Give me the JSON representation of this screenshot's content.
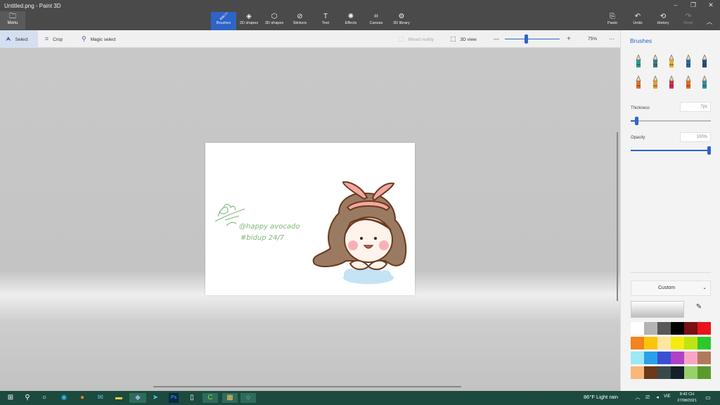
{
  "window": {
    "title": "Untitled.png - Paint 3D",
    "controls": [
      "–",
      "❐",
      "✕"
    ]
  },
  "ribbon": {
    "menu_label": "Menu",
    "tools": [
      {
        "label": "Brushes",
        "icon": "brush-icon",
        "glyph": "🖌"
      },
      {
        "label": "2D shapes",
        "icon": "shapes-2d-icon",
        "glyph": "◈"
      },
      {
        "label": "3D shapes",
        "icon": "cube-icon",
        "glyph": "⬡"
      },
      {
        "label": "Stickers",
        "icon": "sticker-icon",
        "glyph": "⊘"
      },
      {
        "label": "Text",
        "icon": "text-icon",
        "glyph": "T"
      },
      {
        "label": "Effects",
        "icon": "effects-icon",
        "glyph": "✺"
      },
      {
        "label": "Canvas",
        "icon": "canvas-icon",
        "glyph": "⌗"
      },
      {
        "label": "3D library",
        "icon": "library-icon",
        "glyph": "⚙"
      }
    ],
    "active_tool": "Brushes",
    "right_tools": [
      {
        "label": "Paste",
        "icon": "paste-icon",
        "glyph": "📋",
        "enabled": true
      },
      {
        "label": "Undo",
        "icon": "undo-icon",
        "glyph": "↶",
        "enabled": true
      },
      {
        "label": "History",
        "icon": "history-icon",
        "glyph": "⟲",
        "enabled": true
      },
      {
        "label": "Redo",
        "icon": "redo-icon",
        "glyph": "↷",
        "enabled": false
      }
    ]
  },
  "subbar": {
    "select_label": "Select",
    "crop_label": "Crop",
    "magic_label": "Magic select",
    "mixed_reality_label": "Mixed reality",
    "view3d_label": "3D view",
    "zoom_minus": "—",
    "zoom_plus": "+",
    "zoom_value": "75%",
    "zoom_fraction": 0.42,
    "more": "···"
  },
  "canvas_art": {
    "signature_line1": "@happy avocado",
    "signature_line2": "#bidup 24/7",
    "ink_color": "#7fb87a"
  },
  "panel": {
    "title": "Brushes",
    "brushes": [
      {
        "name": "marker-brush-icon",
        "color": "#2e9c8f"
      },
      {
        "name": "calligraphy-pen-icon",
        "color": "#3a7a8a"
      },
      {
        "name": "oil-brush-icon",
        "color": "#e0b030"
      },
      {
        "name": "watercolor-brush-icon",
        "color": "#2a6a9a"
      },
      {
        "name": "pixel-pen-icon",
        "color": "#2a4a7a"
      },
      {
        "name": "pencil-icon",
        "color": "#e07030"
      },
      {
        "name": "eraser-icon",
        "color": "#e0a030"
      },
      {
        "name": "crayon-icon",
        "color": "#d03050"
      },
      {
        "name": "spray-can-icon",
        "color": "#e06a20"
      },
      {
        "name": "fill-bucket-icon",
        "color": "#3a8a9a"
      }
    ],
    "thickness_label": "Thickness",
    "thickness_value": "7px",
    "thickness_fraction": 0.07,
    "opacity_label": "Opacity",
    "opacity_value": "100%",
    "opacity_fraction": 1.0,
    "custom_label": "Custom",
    "colors": [
      "#ffffff",
      "#b4b4b4",
      "#585858",
      "#000000",
      "#7a0f14",
      "#e8141c",
      "#f5831b",
      "#fdc40d",
      "#fbe7a0",
      "#f7ea0f",
      "#bde511",
      "#2fc82c",
      "#9be9f6",
      "#2aa0e8",
      "#3b4fd2",
      "#b041c7",
      "#f6a6c4",
      "#b07a5a",
      "#f9b77a",
      "#6a3a1a",
      "#3a4a4a",
      "#14202a",
      "#9ad06a",
      "#5a9a2a"
    ]
  },
  "taskbar": {
    "weather": "86°F  Light rain",
    "lang": "VIE",
    "time": "8:42 CH",
    "date": "27/08/2021"
  }
}
